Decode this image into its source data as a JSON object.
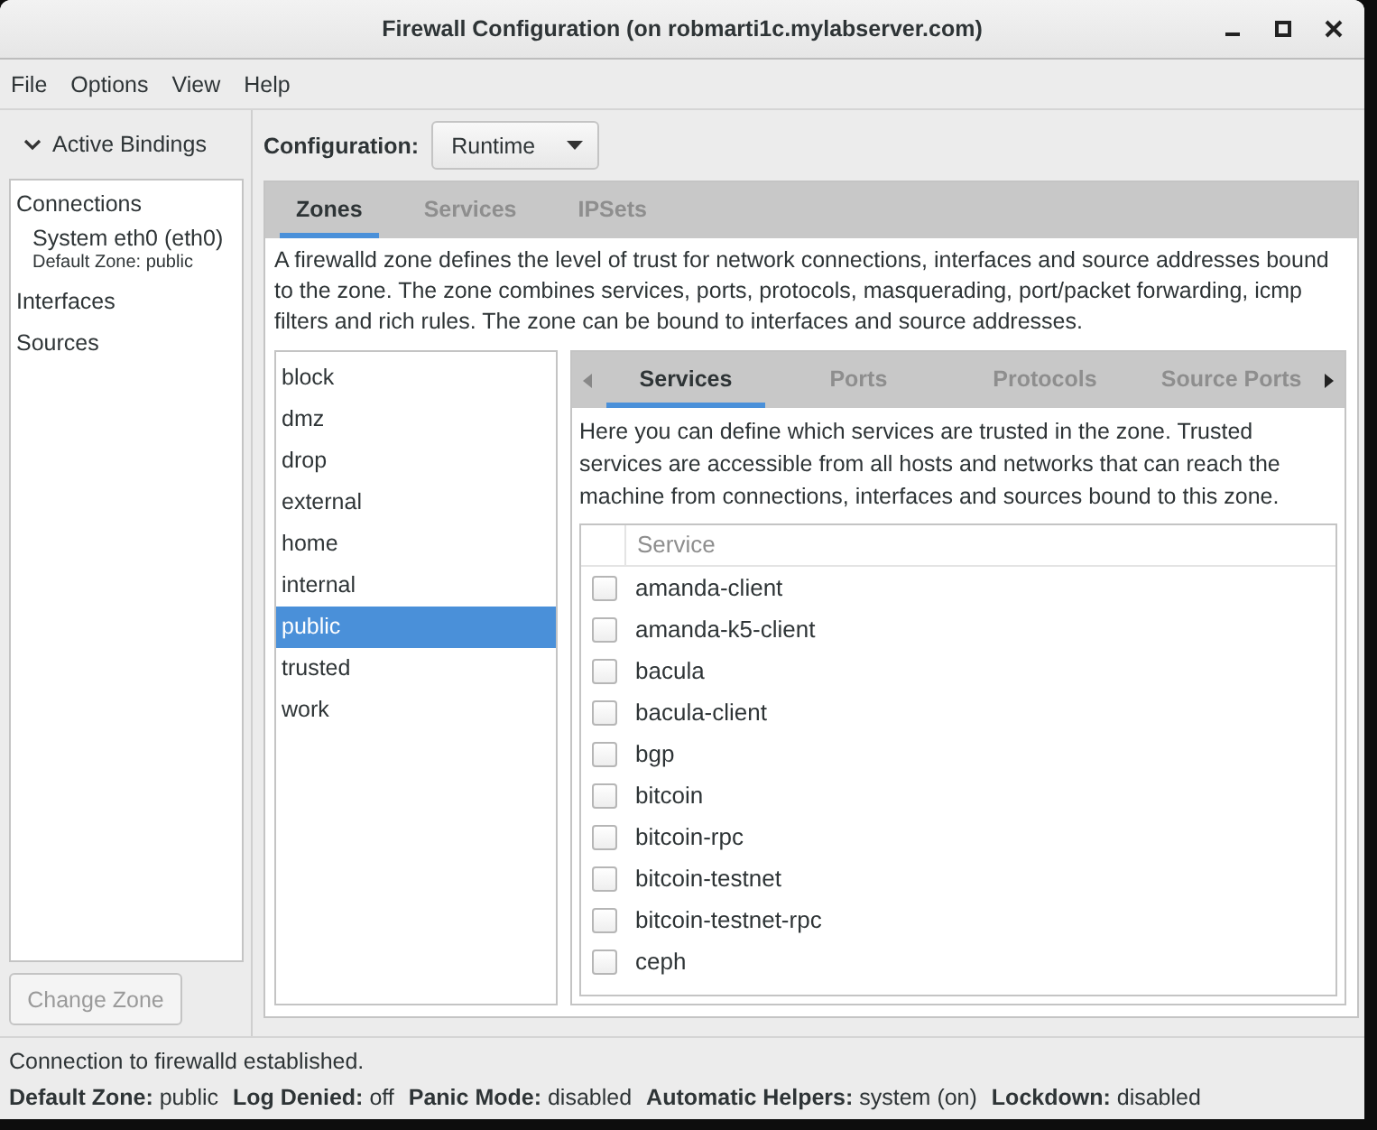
{
  "window": {
    "title": "Firewall Configuration (on robmarti1c.mylabserver.com)"
  },
  "menu": [
    "File",
    "Options",
    "View",
    "Help"
  ],
  "bindings": {
    "header": "Active Bindings",
    "expanded": true,
    "items": [
      {
        "kind": "heading",
        "label": "Connections"
      },
      {
        "kind": "connection",
        "label": "System eth0 (eth0)",
        "sub": "Default Zone: public"
      },
      {
        "kind": "heading",
        "label": "Interfaces"
      },
      {
        "kind": "heading",
        "label": "Sources"
      }
    ],
    "button": {
      "label": "Change Zone",
      "disabled": true
    }
  },
  "configuration": {
    "label": "Configuration:",
    "value": "Runtime"
  },
  "tabs": [
    {
      "label": "Zones",
      "selected": true
    },
    {
      "label": "Services",
      "selected": false
    },
    {
      "label": "IPSets",
      "selected": false
    }
  ],
  "zone_description": "A firewalld zone defines the level of trust for network connections, interfaces and source addresses bound to the zone. The zone combines services, ports, protocols, masquerading, port/packet forwarding, icmp filters and rich rules. The zone can be bound to interfaces and source addresses.",
  "zones": [
    {
      "label": "block",
      "selected": false
    },
    {
      "label": "dmz",
      "selected": false
    },
    {
      "label": "drop",
      "selected": false
    },
    {
      "label": "external",
      "selected": false
    },
    {
      "label": "home",
      "selected": false
    },
    {
      "label": "internal",
      "selected": false
    },
    {
      "label": "public",
      "selected": true
    },
    {
      "label": "trusted",
      "selected": false
    },
    {
      "label": "work",
      "selected": false
    }
  ],
  "zone_tabs": [
    {
      "label": "Services",
      "selected": true
    },
    {
      "label": "Ports",
      "selected": false
    },
    {
      "label": "Protocols",
      "selected": false
    },
    {
      "label": "Source Ports",
      "selected": false
    }
  ],
  "services_description": "Here you can define which services are trusted in the zone. Trusted services are accessible from all hosts and networks that can reach the machine from connections, interfaces and sources bound to this zone.",
  "services_table": {
    "columns": [
      "Service"
    ],
    "rows": [
      {
        "name": "amanda-client",
        "checked": false
      },
      {
        "name": "amanda-k5-client",
        "checked": false
      },
      {
        "name": "bacula",
        "checked": false
      },
      {
        "name": "bacula-client",
        "checked": false
      },
      {
        "name": "bgp",
        "checked": false
      },
      {
        "name": "bitcoin",
        "checked": false
      },
      {
        "name": "bitcoin-rpc",
        "checked": false
      },
      {
        "name": "bitcoin-testnet",
        "checked": false
      },
      {
        "name": "bitcoin-testnet-rpc",
        "checked": false
      },
      {
        "name": "ceph",
        "checked": false
      }
    ]
  },
  "status_bar": {
    "message": "Connection to firewalld established.",
    "fields": [
      {
        "label": "Default Zone:",
        "value": "public"
      },
      {
        "label": "Log Denied:",
        "value": "off"
      },
      {
        "label": "Panic Mode:",
        "value": "disabled"
      },
      {
        "label": "Automatic Helpers:",
        "value": "system (on)"
      },
      {
        "label": "Lockdown:",
        "value": "disabled"
      }
    ]
  }
}
